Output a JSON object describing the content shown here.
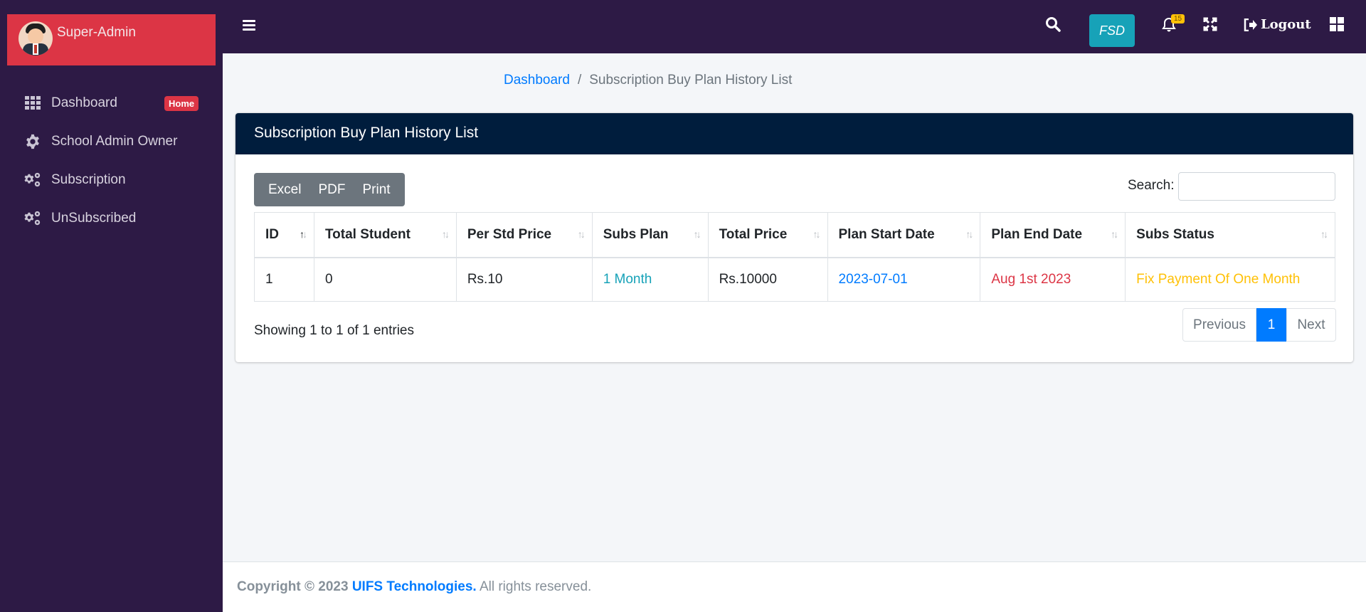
{
  "sidebar": {
    "user_name": "Super-Admin",
    "items": [
      {
        "label": "Dashboard",
        "icon": "grid-icon",
        "badge": "Home"
      },
      {
        "label": "School Admin Owner",
        "icon": "gear-icon"
      },
      {
        "label": "Subscription",
        "icon": "gears-icon"
      },
      {
        "label": "UnSubscribed",
        "icon": "gears-icon"
      }
    ]
  },
  "topbar": {
    "fsd_label": "FSD",
    "notification_count": "15",
    "logout_label": "Logout"
  },
  "breadcrumb": {
    "home": "Dashboard",
    "separator": "/",
    "current": "Subscription Buy Plan History List"
  },
  "card": {
    "title": "Subscription Buy Plan History List",
    "buttons": {
      "excel": "Excel",
      "pdf": "PDF",
      "print": "Print"
    },
    "search_label": "Search:",
    "search_value": ""
  },
  "table": {
    "columns": [
      "ID",
      "Total Student",
      "Per Std Price",
      "Subs Plan",
      "Total Price",
      "Plan Start Date",
      "Plan End Date",
      "Subs Status"
    ],
    "rows": [
      [
        "1",
        "0",
        "Rs.10",
        "1 Month",
        "Rs.10000",
        "2023-07-01",
        "Aug 1st 2023",
        "Fix Payment Of One Month"
      ]
    ]
  },
  "pagination": {
    "info": "Showing 1 to 1 of 1 entries",
    "previous": "Previous",
    "current": "1",
    "next": "Next"
  },
  "footer": {
    "copyright": "Copyright © 2023",
    "company": "UIFS Technologies.",
    "rights": "All rights reserved."
  },
  "colors": {
    "sidebar_bg": "#2d1a45",
    "user_panel": "#dc3545",
    "card_header": "#001d3d",
    "primary": "#007bff",
    "info": "#17a2b8",
    "danger": "#dc3545",
    "warning": "#ffc107"
  }
}
